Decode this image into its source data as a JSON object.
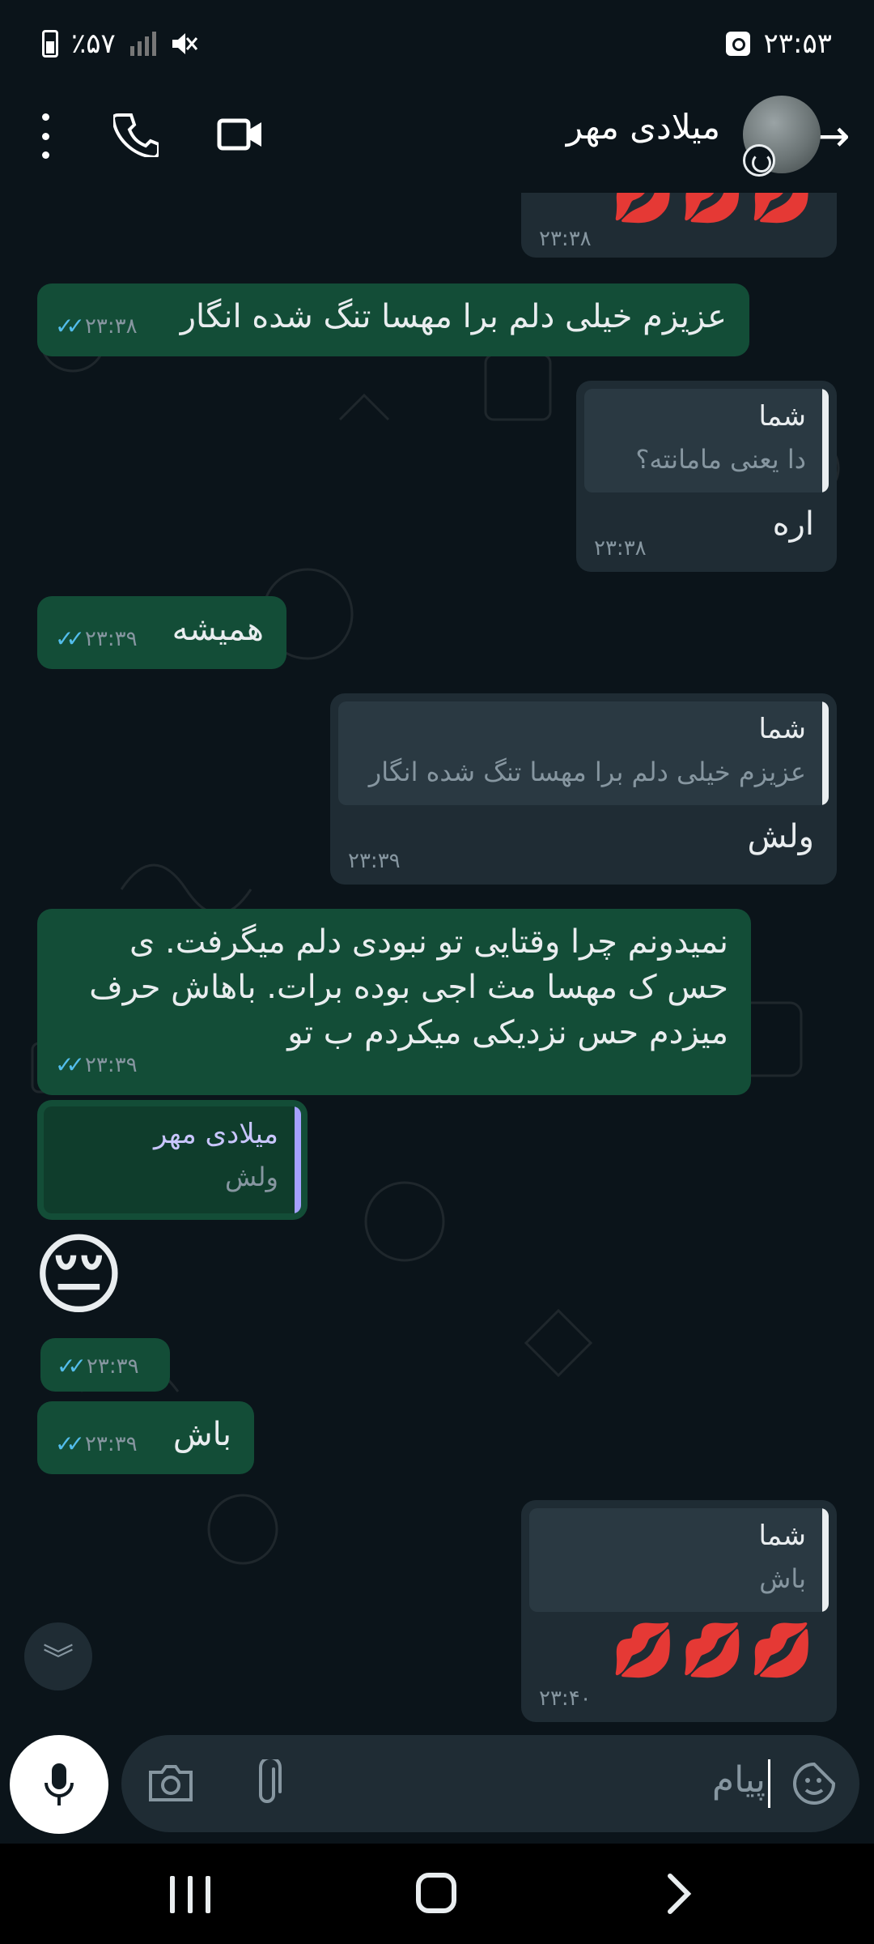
{
  "status_bar": {
    "time": "۲۳:۵۳",
    "battery": "٪۵۷"
  },
  "header": {
    "contact_name": "میلادی مهر"
  },
  "messages": [
    {
      "type": "incoming-sticker",
      "content": "💋💋💋",
      "time": "۲۳:۳۸"
    },
    {
      "type": "outgoing",
      "text": "عزیزم خیلی دلم برا مهسا تنگ شده انگار",
      "time": "۲۳:۳۸",
      "ticks": "✓✓"
    },
    {
      "type": "incoming-reply",
      "quote_author": "شما",
      "quote_text": "دا یعنی مامانته؟",
      "text": "اره",
      "time": "۲۳:۳۸"
    },
    {
      "type": "outgoing",
      "text": "همیشه",
      "time": "۲۳:۳۹",
      "ticks": "✓✓"
    },
    {
      "type": "incoming-reply",
      "quote_author": "شما",
      "quote_text": "عزیزم خیلی دلم برا مهسا تنگ شده انگار",
      "text": "ولش",
      "time": "۲۳:۳۹"
    },
    {
      "type": "outgoing",
      "lines": [
        "نمیدونم چرا وقتایی  تو نبودی  دلم میگرفت. ی",
        "حس ک مهسا مث اجی بوده برات. باهاش حرف",
        "میزدم حس  نزدیکی میکردم ب تو"
      ],
      "time": "۲۳:۳۹",
      "ticks": "✓✓"
    },
    {
      "type": "outgoing-reply-emoji",
      "quote_author": "میلادی مهر",
      "quote_text": "ولش",
      "emoji": "😔",
      "time": "۲۳:۳۹",
      "ticks": "✓✓"
    },
    {
      "type": "outgoing",
      "text": "باش",
      "time": "۲۳:۳۹",
      "ticks": "✓✓"
    },
    {
      "type": "incoming-reply-sticker",
      "quote_author": "شما",
      "quote_text": "باش",
      "content": "💋💋💋",
      "time": "۲۳:۴۰"
    }
  ],
  "input": {
    "placeholder": "پیام"
  },
  "icons": {
    "back": "arrow-right-icon",
    "video": "video-call-icon",
    "phone": "phone-icon",
    "more": "more-vertical-icon",
    "mic": "microphone-icon",
    "camera": "camera-icon",
    "attach": "paperclip-icon",
    "sticker": "sticker-icon",
    "scroll_down": "double-chevron-down-icon"
  },
  "colors": {
    "background": "#0b141a",
    "outgoing_bubble": "#134d37",
    "incoming_bubble": "#1f2c34",
    "read_ticks": "#53bdeb"
  }
}
